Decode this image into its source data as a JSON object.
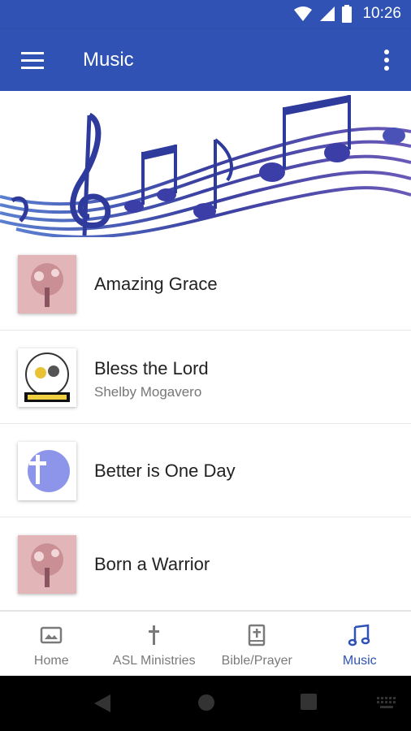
{
  "status_bar": {
    "time": "10:26"
  },
  "app_bar": {
    "title": "Music"
  },
  "songs": [
    {
      "title": "Amazing Grace",
      "subtitle": ""
    },
    {
      "title": "Bless the Lord",
      "subtitle": "Shelby Mogavero"
    },
    {
      "title": "Better is One Day",
      "subtitle": ""
    },
    {
      "title": "Born a Warrior",
      "subtitle": ""
    }
  ],
  "bottom_nav": [
    {
      "label": "Home",
      "icon": "image-icon",
      "active": false
    },
    {
      "label": "ASL Ministries",
      "icon": "cross-icon",
      "active": false
    },
    {
      "label": "Bible/Prayer",
      "icon": "bible-icon",
      "active": false
    },
    {
      "label": "Music",
      "icon": "music-note-icon",
      "active": true
    }
  ],
  "colors": {
    "primary": "#2f52b4",
    "inactive": "#7a7a7a",
    "hero_notes": "#3a3fa0"
  }
}
